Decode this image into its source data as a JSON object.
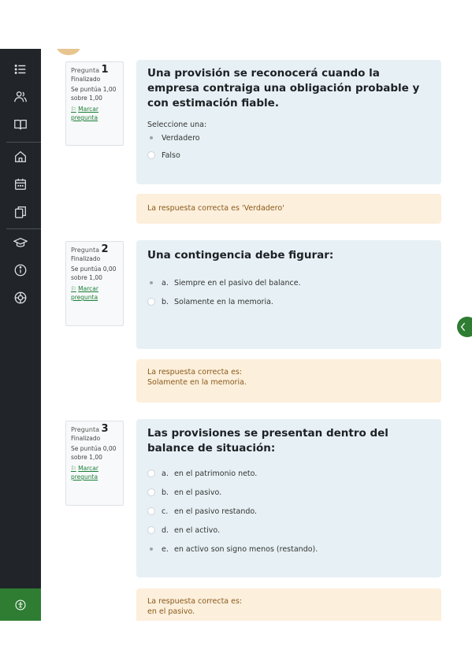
{
  "questions": [
    {
      "label": "Pregunta",
      "number": "1",
      "state": "Finalizado",
      "score": "Se puntúa 1,00 sobre 1,00",
      "flag": "Marcar pregunta",
      "text": "Una provisión se reconocerá cuando la empresa contraiga una obligación probable y con estimación fiable.",
      "prompt": "Seleccione una:",
      "options": [
        {
          "letter": "",
          "text": "Verdadero",
          "selected": true
        },
        {
          "letter": "",
          "text": "Falso",
          "selected": false
        }
      ],
      "feedback": [
        "La respuesta correcta es 'Verdadero'"
      ]
    },
    {
      "label": "Pregunta",
      "number": "2",
      "state": "Finalizado",
      "score": "Se puntúa 0,00 sobre 1,00",
      "flag": "Marcar pregunta",
      "text": "Una contingencia debe figurar:",
      "prompt": "",
      "options": [
        {
          "letter": "a.",
          "text": "Siempre en el pasivo del balance.",
          "selected": true
        },
        {
          "letter": "b.",
          "text": "Solamente en la memoria.",
          "selected": false
        }
      ],
      "feedback": [
        "La respuesta correcta es:",
        "Solamente en la memoria."
      ]
    },
    {
      "label": "Pregunta",
      "number": "3",
      "state": "Finalizado",
      "score": "Se puntúa 0,00 sobre 1,00",
      "flag": "Marcar pregunta",
      "text": "Las provisiones se presentan dentro del balance de situación:",
      "prompt": "",
      "options": [
        {
          "letter": "a.",
          "text": "en el patrimonio neto.",
          "selected": false
        },
        {
          "letter": "b.",
          "text": "en el pasivo.",
          "selected": false
        },
        {
          "letter": "c.",
          "text": "en el pasivo restando.",
          "selected": false
        },
        {
          "letter": "d.",
          "text": "en el activo.",
          "selected": false
        },
        {
          "letter": "e.",
          "text": "en activo son signo menos (restando).",
          "selected": true
        }
      ],
      "feedback": [
        "La respuesta correcta es:",
        "en el pasivo."
      ]
    }
  ],
  "sidebar_icons": [
    "list-icon",
    "user-group-icon",
    "book-icon",
    "home-icon",
    "calendar-icon",
    "copy-icon",
    "graduation-cap-icon",
    "info-icon",
    "settings-icon",
    "accessibility-icon"
  ],
  "colors": {
    "sidebar": "#212529",
    "question_bg": "#e7f1f5",
    "feedback_bg": "#fcefdc",
    "accent_green": "#2e7d32"
  }
}
